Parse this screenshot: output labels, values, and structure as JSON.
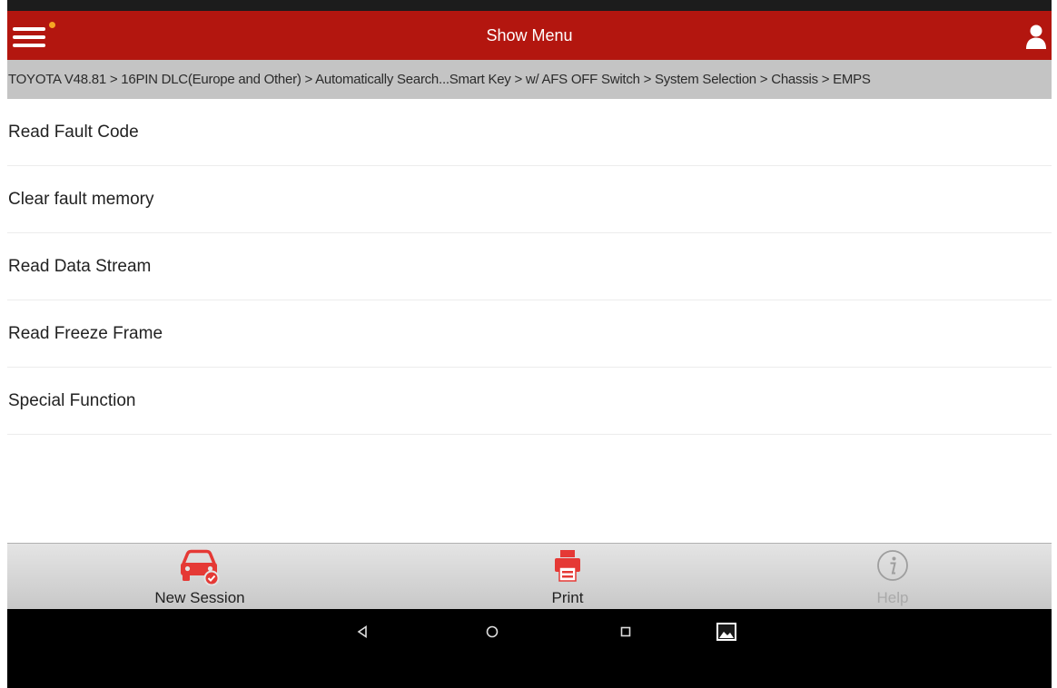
{
  "app_bar": {
    "title": "Show Menu",
    "menu_icon": "hamburger-icon",
    "user_icon": "user-icon",
    "color": "#b3160f"
  },
  "breadcrumb": "TOYOTA V48.81 > 16PIN DLC(Europe and Other) > Automatically Search...Smart Key > w/ AFS OFF Switch > System Selection > Chassis > EMPS",
  "menu_items": [
    {
      "label": "Read Fault Code"
    },
    {
      "label": "Clear fault memory"
    },
    {
      "label": "Read Data Stream"
    },
    {
      "label": "Read Freeze Frame"
    },
    {
      "label": "Special Function"
    }
  ],
  "toolbar": {
    "new_session": {
      "label": "New Session",
      "icon": "car-check-icon"
    },
    "print": {
      "label": "Print",
      "icon": "printer-icon"
    },
    "help": {
      "label": "Help",
      "icon": "info-icon",
      "disabled": true
    },
    "accent": "#e53935"
  },
  "android_nav": {
    "back_icon": "back-triangle-icon",
    "home_icon": "home-circle-icon",
    "recents_icon": "recents-square-icon",
    "screenshot_icon": "image-icon"
  }
}
